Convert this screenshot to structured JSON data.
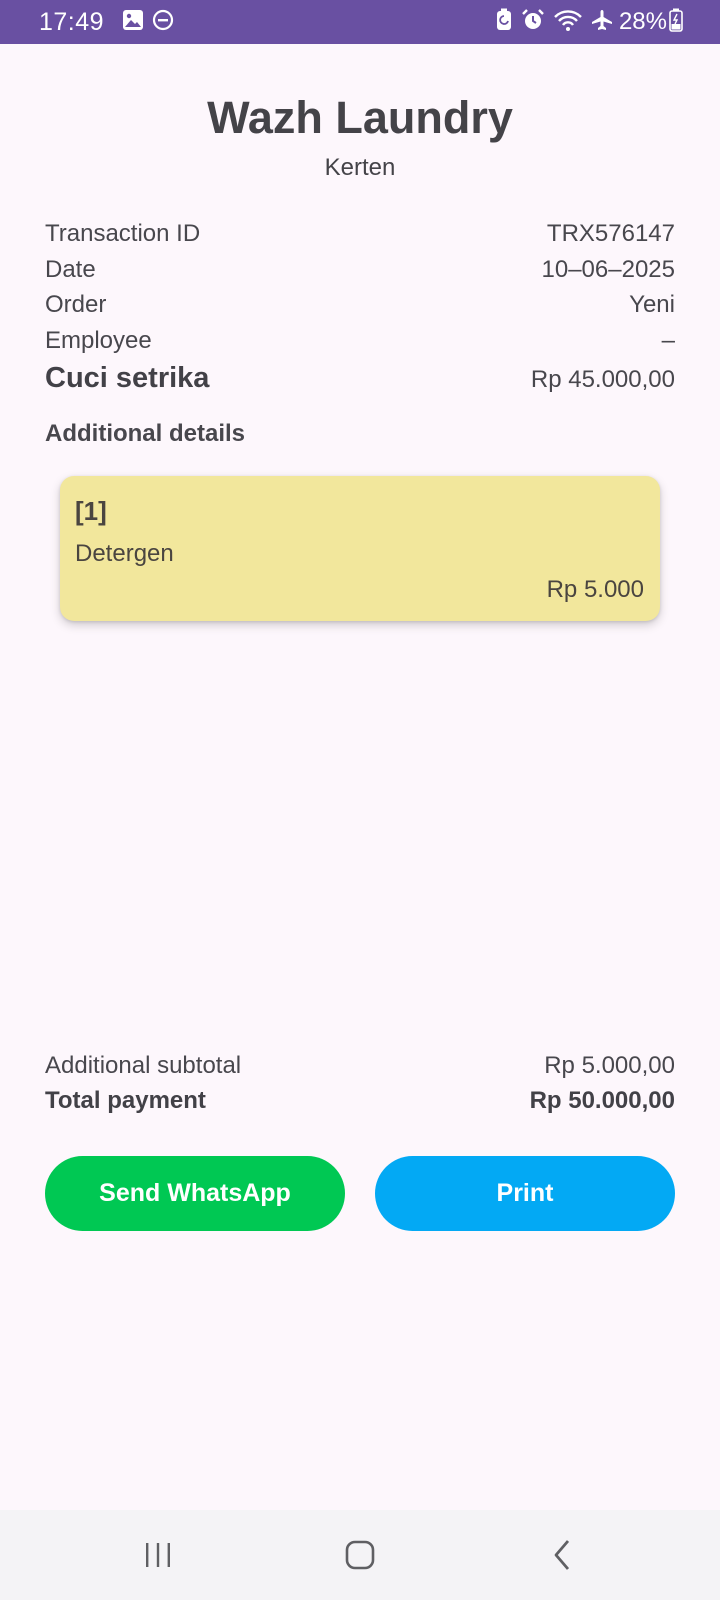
{
  "status_bar": {
    "time": "17:49",
    "battery": "28%",
    "icons": [
      "gallery-icon",
      "dnd-icon",
      "battery-saver-icon",
      "alarm-icon",
      "wifi-icon",
      "airplane-icon",
      "battery-icon"
    ]
  },
  "header": {
    "title": "Wazh Laundry",
    "subtitle": "Kerten"
  },
  "info": {
    "transaction_id": {
      "label": "Transaction ID",
      "value": "TRX576147"
    },
    "date": {
      "label": "Date",
      "value": "10–06–2025"
    },
    "order": {
      "label": "Order",
      "value": "Yeni"
    },
    "employee": {
      "label": "Employee",
      "value": "–"
    },
    "service": {
      "label": "Cuci setrika",
      "value": "Rp 45.000,00"
    }
  },
  "additional": {
    "title": "Additional details",
    "items": [
      {
        "index": "[1]",
        "name": "Detergen",
        "price": "Rp 5.000"
      }
    ]
  },
  "totals": {
    "subtotal": {
      "label": "Additional subtotal",
      "value": "Rp 5.000,00"
    },
    "total": {
      "label": "Total payment",
      "value": "Rp 50.000,00"
    }
  },
  "actions": {
    "whatsapp_label": "Send WhatsApp",
    "print_label": "Print"
  },
  "colors": {
    "status_bar": "#6950a2",
    "whatsapp": "#00c853",
    "print": "#03a9f4",
    "card": "#f2e79c",
    "background": "#fdf7fc"
  },
  "nav_bar": {
    "buttons": [
      "recent-apps-icon",
      "home-icon",
      "back-icon"
    ]
  }
}
